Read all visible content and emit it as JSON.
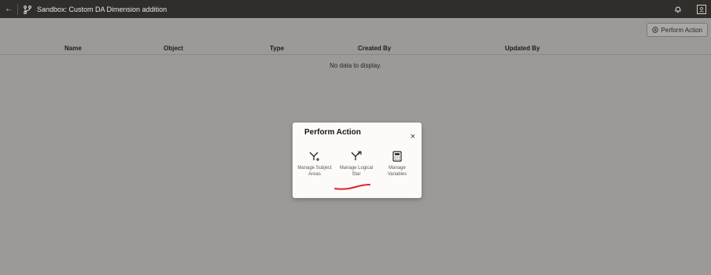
{
  "window": {
    "title": "Sandbox: Custom DA Dimension addition"
  },
  "toolbar": {
    "perform_action_label": "Perform Action"
  },
  "table": {
    "columns": [
      "Name",
      "Object",
      "Type",
      "Created By",
      "Updated By"
    ],
    "empty_text": "No data to display."
  },
  "dialog": {
    "title": "Perform Action",
    "close_glyph": "×",
    "options": [
      {
        "icon": "subject-areas-icon",
        "label_line1": "Manage Subject",
        "label_line2": "Areas"
      },
      {
        "icon": "logical-star-icon",
        "label_line1": "Manage Logical",
        "label_line2": "Star"
      },
      {
        "icon": "calculator-icon",
        "label_line1": "Manage",
        "label_line2": "Variables"
      }
    ]
  },
  "colors": {
    "topbar": "#312d2a",
    "overlay": "#9b9a98",
    "annotation": "#e3202a"
  }
}
